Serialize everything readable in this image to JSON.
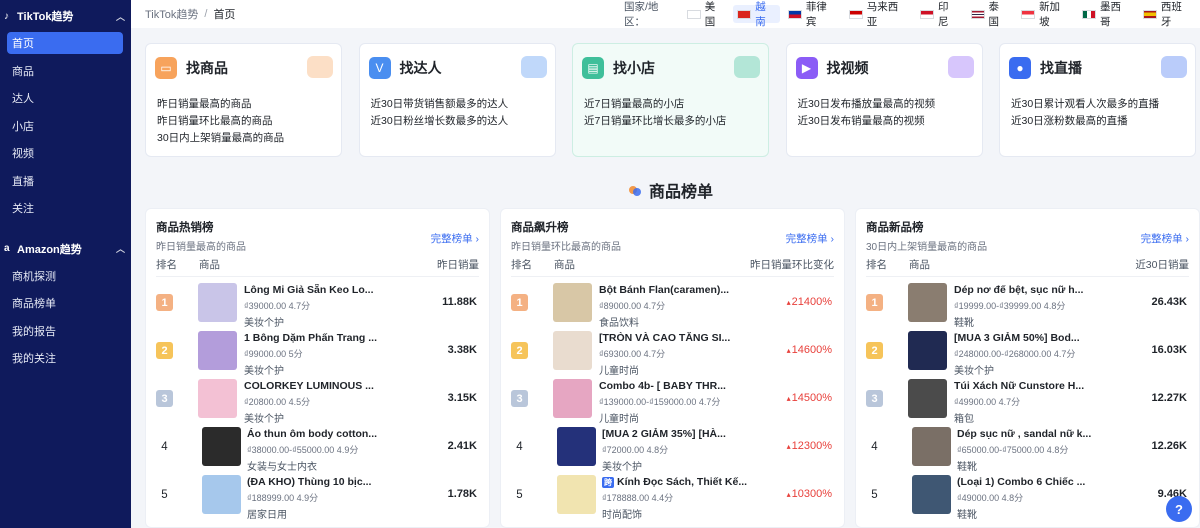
{
  "sidebar": {
    "tiktok": {
      "title": "TikTok趋势",
      "icon": "tiktok-icon"
    },
    "tiktok_items": [
      "首页",
      "商品",
      "达人",
      "小店",
      "视频",
      "直播",
      "关注"
    ],
    "amazon": {
      "title": "Amazon趋势",
      "icon": "amazon-icon"
    },
    "amazon_items": [
      "商机探测",
      "商品榜单",
      "我的报告",
      "我的关注"
    ]
  },
  "breadcrumb": {
    "parent": "TikTok趋势",
    "separator": "/",
    "current": "首页"
  },
  "region": {
    "label": "国家/地区：",
    "countries": [
      {
        "name": "美国",
        "active": false
      },
      {
        "name": "越南",
        "active": true
      },
      {
        "name": "菲律宾",
        "active": false
      },
      {
        "name": "马来西亚",
        "active": false
      },
      {
        "name": "印尼",
        "active": false
      },
      {
        "name": "泰国",
        "active": false
      },
      {
        "name": "新加坡",
        "active": false
      },
      {
        "name": "墨西哥",
        "active": false
      },
      {
        "name": "西班牙",
        "active": false
      }
    ]
  },
  "features": [
    {
      "title": "找商品",
      "icon": "shopping-bag-icon",
      "color": "#f7a35c",
      "desc": [
        "昨日销量最高的商品",
        "昨日销量环比最高的商品",
        "30日内上架销量最高的商品"
      ]
    },
    {
      "title": "找达人",
      "icon": "influencer-badge-icon",
      "color": "#4a8ef0",
      "desc": [
        "近30日带货销售额最多的达人",
        "近30日粉丝增长数最多的达人"
      ]
    },
    {
      "title": "找小店",
      "icon": "store-icon",
      "color": "#3fbf9a",
      "desc": [
        "近7日销量最高的小店",
        "近7日销量环比增长最多的小店"
      ]
    },
    {
      "title": "找视频",
      "icon": "video-play-icon",
      "color": "#8b5cf6",
      "desc": [
        "近30日发布播放量最高的视频",
        "近30日发布销量最高的视频"
      ]
    },
    {
      "title": "找直播",
      "icon": "live-camera-icon",
      "color": "#3a6cf0",
      "desc": [
        "近30日累计观看人次最多的直播",
        "近30日涨粉数最高的直播"
      ]
    }
  ],
  "section_title": "商品榜单",
  "panels": [
    {
      "title": "商品热销榜",
      "subtitle": "昨日销量最高的商品",
      "more": "完整榜单 ›",
      "col_rank": "排名",
      "col_product": "商品",
      "col_metric": "昨日销量",
      "rows": [
        {
          "rank": "1",
          "name": "Lông Mi Giả Sẵn Keo Lo...",
          "price": "₫39000.00  4.7分",
          "cat": "美妆个护",
          "metric": "11.88K",
          "tag": ""
        },
        {
          "rank": "2",
          "name": "1 Bông Dặm Phấn Trang ...",
          "price": "₫99000.00  5分",
          "cat": "美妆个护",
          "metric": "3.38K",
          "tag": ""
        },
        {
          "rank": "3",
          "name": "COLORKEY LUMINOUS ...",
          "price": "₫20800.00  4.5分",
          "cat": "美妆个护",
          "metric": "3.15K",
          "tag": ""
        },
        {
          "rank": "4",
          "name": "Áo thun ôm body cotton...",
          "price": "₫38000.00-₫55000.00  4.9分",
          "cat": "女装与女士内衣",
          "metric": "2.41K",
          "tag": ""
        },
        {
          "rank": "5",
          "name": "(ĐA KHO) Thùng 10 bịc...",
          "price": "₫188999.00  4.9分",
          "cat": "居家日用",
          "metric": "1.78K",
          "tag": ""
        }
      ]
    },
    {
      "title": "商品飙升榜",
      "subtitle": "昨日销量环比最高的商品",
      "more": "完整榜单 ›",
      "col_rank": "排名",
      "col_product": "商品",
      "col_metric": "昨日销量环比变化",
      "rows": [
        {
          "rank": "1",
          "name": "Bột Bánh Flan(caramen)...",
          "price": "₫89000.00  4.7分",
          "cat": "食品饮料",
          "metric": "21400%",
          "tag": ""
        },
        {
          "rank": "2",
          "name": "[TRÒN VÀ CAO TĂNG SI...",
          "price": "₫69300.00  4.7分",
          "cat": "儿童时尚",
          "metric": "14600%",
          "tag": ""
        },
        {
          "rank": "3",
          "name": "Combo 4b- [ BABY THR...",
          "price": "₫139000.00-₫159000.00  4.7分",
          "cat": "儿童时尚",
          "metric": "14500%",
          "tag": ""
        },
        {
          "rank": "4",
          "name": "[MUA 2 GIẢM 35%] [HÀ...",
          "price": "₫72000.00  4.8分",
          "cat": "美妆个护",
          "metric": "12300%",
          "tag": ""
        },
        {
          "rank": "5",
          "name": "Kính Đọc Sách, Thiết Kế...",
          "price": "₫178888.00  4.4分",
          "cat": "时尚配饰",
          "metric": "10300%",
          "tag": "跨"
        }
      ]
    },
    {
      "title": "商品新品榜",
      "subtitle": "30日内上架销量最高的商品",
      "more": "完整榜单 ›",
      "col_rank": "排名",
      "col_product": "商品",
      "col_metric": "近30日销量",
      "rows": [
        {
          "rank": "1",
          "name": "Dép nơ đế bệt, sục nữ h...",
          "price": "₫19999.00-₫39999.00  4.8分",
          "cat": "鞋靴",
          "metric": "26.43K",
          "tag": ""
        },
        {
          "rank": "2",
          "name": "[MUA 3 GIẢM 50%] Bod...",
          "price": "₫248000.00-₫268000.00  4.7分",
          "cat": "美妆个护",
          "metric": "16.03K",
          "tag": ""
        },
        {
          "rank": "3",
          "name": "Túi Xách Nữ Cunstore H...",
          "price": "₫49900.00  4.7分",
          "cat": "箱包",
          "metric": "12.27K",
          "tag": ""
        },
        {
          "rank": "4",
          "name": "Dép sục nữ , sandal nữ k...",
          "price": "₫65000.00-₫75000.00  4.8分",
          "cat": "鞋靴",
          "metric": "12.26K",
          "tag": ""
        },
        {
          "rank": "5",
          "name": "(Loại 1) Combo 6 Chiếc ...",
          "price": "₫49000.00  4.8分",
          "cat": "鞋靴",
          "metric": "9.46K",
          "tag": ""
        }
      ]
    }
  ],
  "help": {
    "label": "?"
  }
}
